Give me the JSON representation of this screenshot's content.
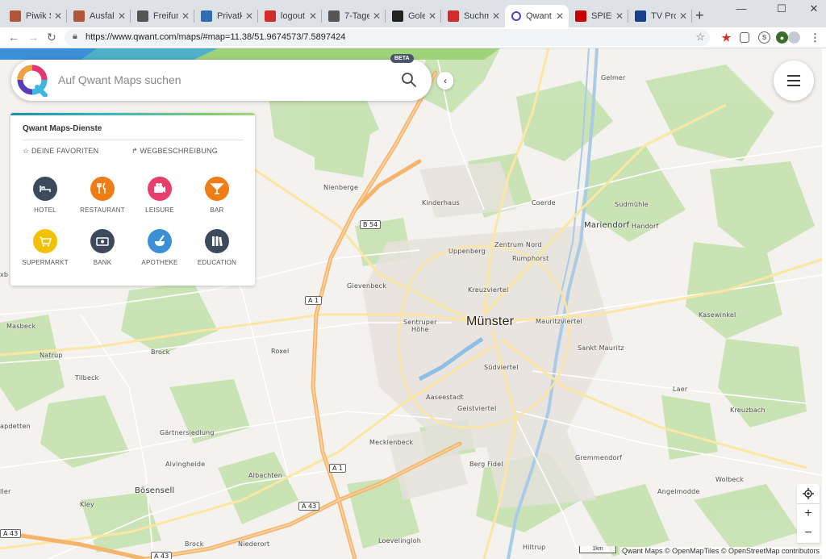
{
  "browser": {
    "tabs": [
      {
        "title": "Piwik S",
        "fav_color": "#b0563a"
      },
      {
        "title": "Ausfall",
        "fav_color": "#b0563a"
      },
      {
        "title": "Freifun",
        "fav_color": "#555555"
      },
      {
        "title": "Privatk",
        "fav_color": "#2d6fb0"
      },
      {
        "title": "logout",
        "fav_color": "#d12b2b"
      },
      {
        "title": "7-Tage",
        "fav_color": "#555555"
      },
      {
        "title": "Golem",
        "fav_color": "#222222"
      },
      {
        "title": "Suchm",
        "fav_color": "#d12b2b"
      },
      {
        "title": "Qwant",
        "fav_color": "#ffffff"
      },
      {
        "title": "SPIEGE",
        "fav_color": "#c40000"
      },
      {
        "title": "TV Pro",
        "fav_color": "#1a3f8c"
      }
    ],
    "close_glyph": "✕",
    "new_tab": "+",
    "window_controls": {
      "minimize": "—",
      "maximize": "☐",
      "close": "✕"
    },
    "nav": {
      "back": "←",
      "forward": "→",
      "reload": "↻"
    },
    "url": "https://www.qwant.com/maps/#map=11.38/51.9674573/7.5897424"
  },
  "search": {
    "placeholder": "Auf Qwant Maps suchen",
    "beta": "BETA",
    "collapse_glyph": "‹"
  },
  "panel": {
    "title": "Qwant Maps-Dienste",
    "favorites": "☆ DEINE FAVORITEN",
    "directions": "↱ WEGBESCHREIBUNG",
    "categories": [
      {
        "label": "HOTEL",
        "color": "#3d4a5c",
        "icon": "bed-icon"
      },
      {
        "label": "RESTAURANT",
        "color": "#ef7d15",
        "icon": "cutlery-icon"
      },
      {
        "label": "LEISURE",
        "color": "#e83e6c",
        "icon": "camera-icon"
      },
      {
        "label": "BAR",
        "color": "#ef7d15",
        "icon": "cocktail-icon"
      },
      {
        "label": "SUPERMARKT",
        "color": "#f2c200",
        "icon": "cart-icon"
      },
      {
        "label": "BANK",
        "color": "#3d4a5c",
        "icon": "banknote-icon"
      },
      {
        "label": "APOTHEKE",
        "color": "#3a8fd6",
        "icon": "mortar-icon"
      },
      {
        "label": "EDUCATION",
        "color": "#3d4a5c",
        "icon": "books-icon"
      }
    ]
  },
  "map": {
    "places": [
      {
        "name": "Münster",
        "size": "big"
      },
      {
        "name": "Nienberge"
      },
      {
        "name": "Kinderhaus"
      },
      {
        "name": "Coerde"
      },
      {
        "name": "Gelmer"
      },
      {
        "name": "Sudmühle"
      },
      {
        "name": "Mariendorf",
        "size": "mid"
      },
      {
        "name": "Handorf"
      },
      {
        "name": "Zentrum Nord"
      },
      {
        "name": "Rumphorst"
      },
      {
        "name": "Uppenberg"
      },
      {
        "name": "Gievenbeck"
      },
      {
        "name": "Kreuzviertel"
      },
      {
        "name": "Sentruper"
      },
      {
        "name": "Höhe"
      },
      {
        "name": "Mauritzviertel"
      },
      {
        "name": "Kasewinkel"
      },
      {
        "name": "Masbeck"
      },
      {
        "name": "Natrup"
      },
      {
        "name": "Brock"
      },
      {
        "name": "Roxel"
      },
      {
        "name": "Sankt Mauritz"
      },
      {
        "name": "Südviertel"
      },
      {
        "name": "Tilbeck"
      },
      {
        "name": "Aaseestadt"
      },
      {
        "name": "Geistviertel"
      },
      {
        "name": "Laer"
      },
      {
        "name": "Kreuzbach"
      },
      {
        "name": "apdetten"
      },
      {
        "name": "Gärtnersiedlung"
      },
      {
        "name": "Mecklenbeck"
      },
      {
        "name": "Alvingheide"
      },
      {
        "name": "Albachten"
      },
      {
        "name": "Berg Fidel"
      },
      {
        "name": "Gremmendorf"
      },
      {
        "name": "Bösensell",
        "size": "mid"
      },
      {
        "name": "Wolbeck"
      },
      {
        "name": "ller"
      },
      {
        "name": "Kley"
      },
      {
        "name": "Angelmodde"
      },
      {
        "name": "Brock"
      },
      {
        "name": "Niederort"
      },
      {
        "name": "Loevelingloh"
      },
      {
        "name": "Hiltrup"
      },
      {
        "name": "xb"
      }
    ],
    "roads": [
      "B 54",
      "A 1",
      "A 1",
      "A 43",
      "A 43",
      "A 43"
    ],
    "scale": "1km",
    "attribution": "Qwant Maps © OpenMapTiles © OpenStreetMap contributors",
    "zoom_in": "+",
    "zoom_out": "−"
  }
}
